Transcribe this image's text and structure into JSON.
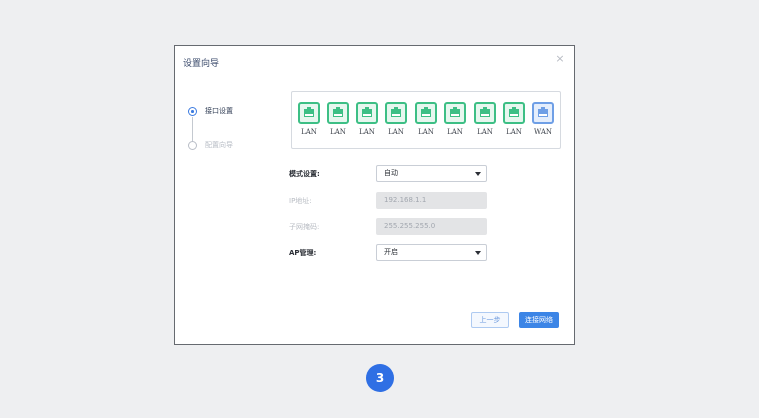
{
  "dialog": {
    "title": "设置向导",
    "close_glyph": "×"
  },
  "steps": [
    {
      "label": "接口设置",
      "state": "active"
    },
    {
      "label": "配置向导",
      "state": "inactive"
    }
  ],
  "ports": [
    {
      "label": "LAN",
      "type": "lan"
    },
    {
      "label": "LAN",
      "type": "lan"
    },
    {
      "label": "LAN",
      "type": "lan"
    },
    {
      "label": "LAN",
      "type": "lan"
    },
    {
      "label": "LAN",
      "type": "lan"
    },
    {
      "label": "LAN",
      "type": "lan"
    },
    {
      "label": "LAN",
      "type": "lan"
    },
    {
      "label": "LAN",
      "type": "lan"
    },
    {
      "label": "WAN",
      "type": "wan"
    }
  ],
  "form": {
    "mode": {
      "label": "模式设置:",
      "value": "自动"
    },
    "ip": {
      "label": "IP地址:",
      "value": "192.168.1.1"
    },
    "mask": {
      "label": "子网掩码:",
      "value": "255.255.255.0"
    },
    "ap": {
      "label": "AP管理:",
      "value": "开启"
    }
  },
  "buttons": {
    "prev": "上一步",
    "next": "连接网络"
  },
  "badge": "3",
  "colors": {
    "accent": "#3c85e6",
    "lan_port": "#3dbf85",
    "wan_port": "#6f9fe6",
    "badge": "#2f6fe4"
  }
}
